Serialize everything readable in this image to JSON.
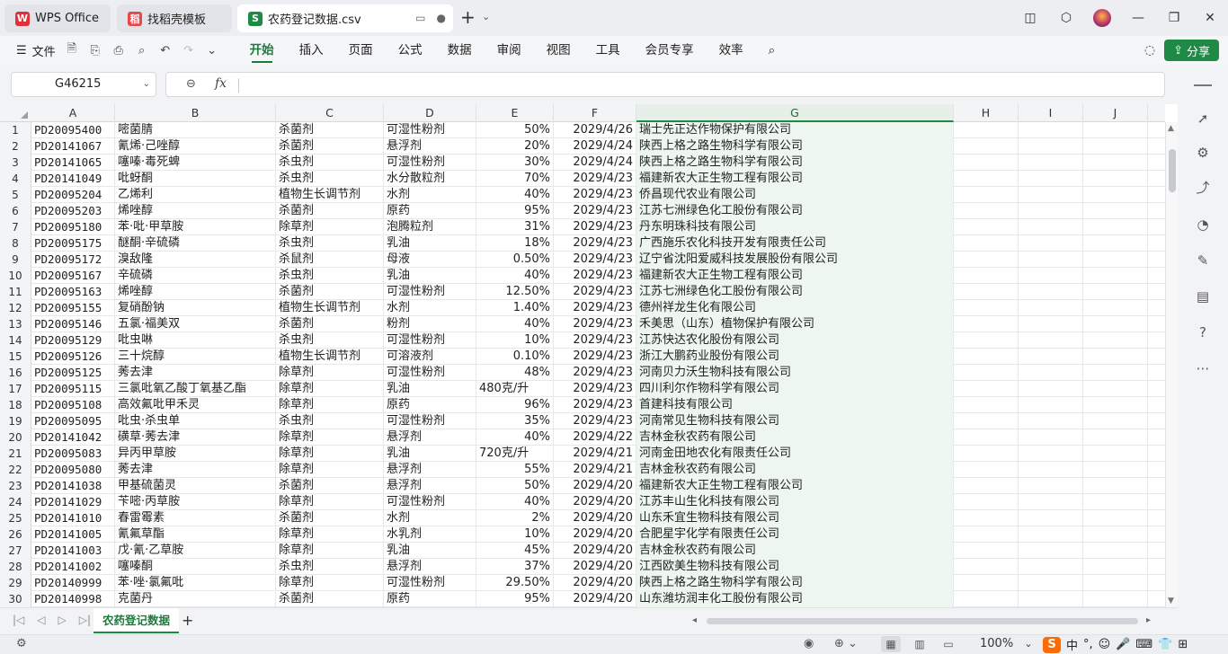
{
  "tabs": {
    "home_label": "WPS Office",
    "template_label": "找稻壳模板",
    "doc_label": "农药登记数据.csv"
  },
  "menu": {
    "file_label": "文件",
    "tabs": [
      "开始",
      "插入",
      "页面",
      "公式",
      "数据",
      "审阅",
      "视图",
      "工具",
      "会员专享",
      "效率"
    ],
    "share_label": "分享"
  },
  "formula_bar": {
    "cell_ref": "G46215",
    "fx_label": "fx",
    "content": ""
  },
  "grid": {
    "columns": [
      "A",
      "B",
      "C",
      "D",
      "E",
      "F",
      "G",
      "H",
      "I",
      "J"
    ],
    "selected_column": "G",
    "rows": [
      [
        "1",
        "PD20095400",
        "嘧菌腈",
        "杀菌剂",
        "可湿性粉剂",
        "50%",
        "2029/4/26",
        "瑞士先正达作物保护有限公司"
      ],
      [
        "2",
        "PD20141067",
        "氰烯·己唑醇",
        "杀菌剂",
        "悬浮剂",
        "20%",
        "2029/4/24",
        "陕西上格之路生物科学有限公司"
      ],
      [
        "3",
        "PD20141065",
        "噻嗪·毒死蜱",
        "杀虫剂",
        "可湿性粉剂",
        "30%",
        "2029/4/24",
        "陕西上格之路生物科学有限公司"
      ],
      [
        "4",
        "PD20141049",
        "吡蚜酮",
        "杀虫剂",
        "水分散粒剂",
        "70%",
        "2029/4/23",
        "福建新农大正生物工程有限公司"
      ],
      [
        "5",
        "PD20095204",
        "乙烯利",
        "植物生长调节剂",
        "水剂",
        "40%",
        "2029/4/23",
        "侨昌现代农业有限公司"
      ],
      [
        "6",
        "PD20095203",
        "烯唑醇",
        "杀菌剂",
        "原药",
        "95%",
        "2029/4/23",
        "江苏七洲绿色化工股份有限公司"
      ],
      [
        "7",
        "PD20095180",
        "苯·吡·甲草胺",
        "除草剂",
        "泡腾粒剂",
        "31%",
        "2029/4/23",
        "丹东明珠科技有限公司"
      ],
      [
        "8",
        "PD20095175",
        "醚酮·辛硫磷",
        "杀虫剂",
        "乳油",
        "18%",
        "2029/4/23",
        "广西施乐农化科技开发有限责任公司"
      ],
      [
        "9",
        "PD20095172",
        "溴敌隆",
        "杀鼠剂",
        "母液",
        "0.50%",
        "2029/4/23",
        "辽宁省沈阳爱威科技发展股份有限公司"
      ],
      [
        "10",
        "PD20095167",
        "辛硫磷",
        "杀虫剂",
        "乳油",
        "40%",
        "2029/4/23",
        "福建新农大正生物工程有限公司"
      ],
      [
        "11",
        "PD20095163",
        "烯唑醇",
        "杀菌剂",
        "可湿性粉剂",
        "12.50%",
        "2029/4/23",
        "江苏七洲绿色化工股份有限公司"
      ],
      [
        "12",
        "PD20095155",
        "复硝酚钠",
        "植物生长调节剂",
        "水剂",
        "1.40%",
        "2029/4/23",
        "德州祥龙生化有限公司"
      ],
      [
        "13",
        "PD20095146",
        "五氯·福美双",
        "杀菌剂",
        "粉剂",
        "40%",
        "2029/4/23",
        "禾美思（山东）植物保护有限公司"
      ],
      [
        "14",
        "PD20095129",
        "吡虫啉",
        "杀虫剂",
        "可湿性粉剂",
        "10%",
        "2029/4/23",
        "江苏快达农化股份有限公司"
      ],
      [
        "15",
        "PD20095126",
        "三十烷醇",
        "植物生长调节剂",
        "可溶液剂",
        "0.10%",
        "2029/4/23",
        "浙江大鹏药业股份有限公司"
      ],
      [
        "16",
        "PD20095125",
        "莠去津",
        "除草剂",
        "可湿性粉剂",
        "48%",
        "2029/4/23",
        "河南贝力沃生物科技有限公司"
      ],
      [
        "17",
        "PD20095115",
        "三氯吡氧乙酸丁氧基乙酯",
        "除草剂",
        "乳油",
        "480克/升",
        "2029/4/23",
        "四川利尔作物科学有限公司"
      ],
      [
        "18",
        "PD20095108",
        "高效氟吡甲禾灵",
        "除草剂",
        "原药",
        "96%",
        "2029/4/23",
        "首建科技有限公司"
      ],
      [
        "19",
        "PD20095095",
        "吡虫·杀虫单",
        "杀虫剂",
        "可湿性粉剂",
        "35%",
        "2029/4/23",
        "河南常见生物科技有限公司"
      ],
      [
        "20",
        "PD20141042",
        "磺草·莠去津",
        "除草剂",
        "悬浮剂",
        "40%",
        "2029/4/22",
        "吉林金秋农药有限公司"
      ],
      [
        "21",
        "PD20095083",
        "异丙甲草胺",
        "除草剂",
        "乳油",
        "720克/升",
        "2029/4/21",
        "河南金田地农化有限责任公司"
      ],
      [
        "22",
        "PD20095080",
        "莠去津",
        "除草剂",
        "悬浮剂",
        "55%",
        "2029/4/21",
        "吉林金秋农药有限公司"
      ],
      [
        "23",
        "PD20141038",
        "甲基硫菌灵",
        "杀菌剂",
        "悬浮剂",
        "50%",
        "2029/4/20",
        "福建新农大正生物工程有限公司"
      ],
      [
        "24",
        "PD20141029",
        "苄嘧·丙草胺",
        "除草剂",
        "可湿性粉剂",
        "40%",
        "2029/4/20",
        "江苏丰山生化科技有限公司"
      ],
      [
        "25",
        "PD20141010",
        "春雷霉素",
        "杀菌剂",
        "水剂",
        "2%",
        "2029/4/20",
        "山东禾宜生物科技有限公司"
      ],
      [
        "26",
        "PD20141005",
        "氰氟草酯",
        "除草剂",
        "水乳剂",
        "10%",
        "2029/4/20",
        "合肥星宇化学有限责任公司"
      ],
      [
        "27",
        "PD20141003",
        "戊·氰·乙草胺",
        "除草剂",
        "乳油",
        "45%",
        "2029/4/20",
        "吉林金秋农药有限公司"
      ],
      [
        "28",
        "PD20141002",
        "噻嗪酮",
        "杀虫剂",
        "悬浮剂",
        "37%",
        "2029/4/20",
        "江西欧美生物科技有限公司"
      ],
      [
        "29",
        "PD20140999",
        "苯·唑·氯氟吡",
        "除草剂",
        "可湿性粉剂",
        "29.50%",
        "2029/4/20",
        "陕西上格之路生物科学有限公司"
      ],
      [
        "30",
        "PD20140998",
        "克菌丹",
        "杀菌剂",
        "原药",
        "95%",
        "2029/4/20",
        "山东潍坊润丰化工股份有限公司"
      ]
    ]
  },
  "sheet": {
    "tab_label": "农药登记数据",
    "add_label": "+"
  },
  "status": {
    "zoom_label": "100%",
    "ime_label": "中"
  },
  "colors": {
    "accent": "#1e8a45",
    "selected_header_bg": "#e6efe8"
  }
}
